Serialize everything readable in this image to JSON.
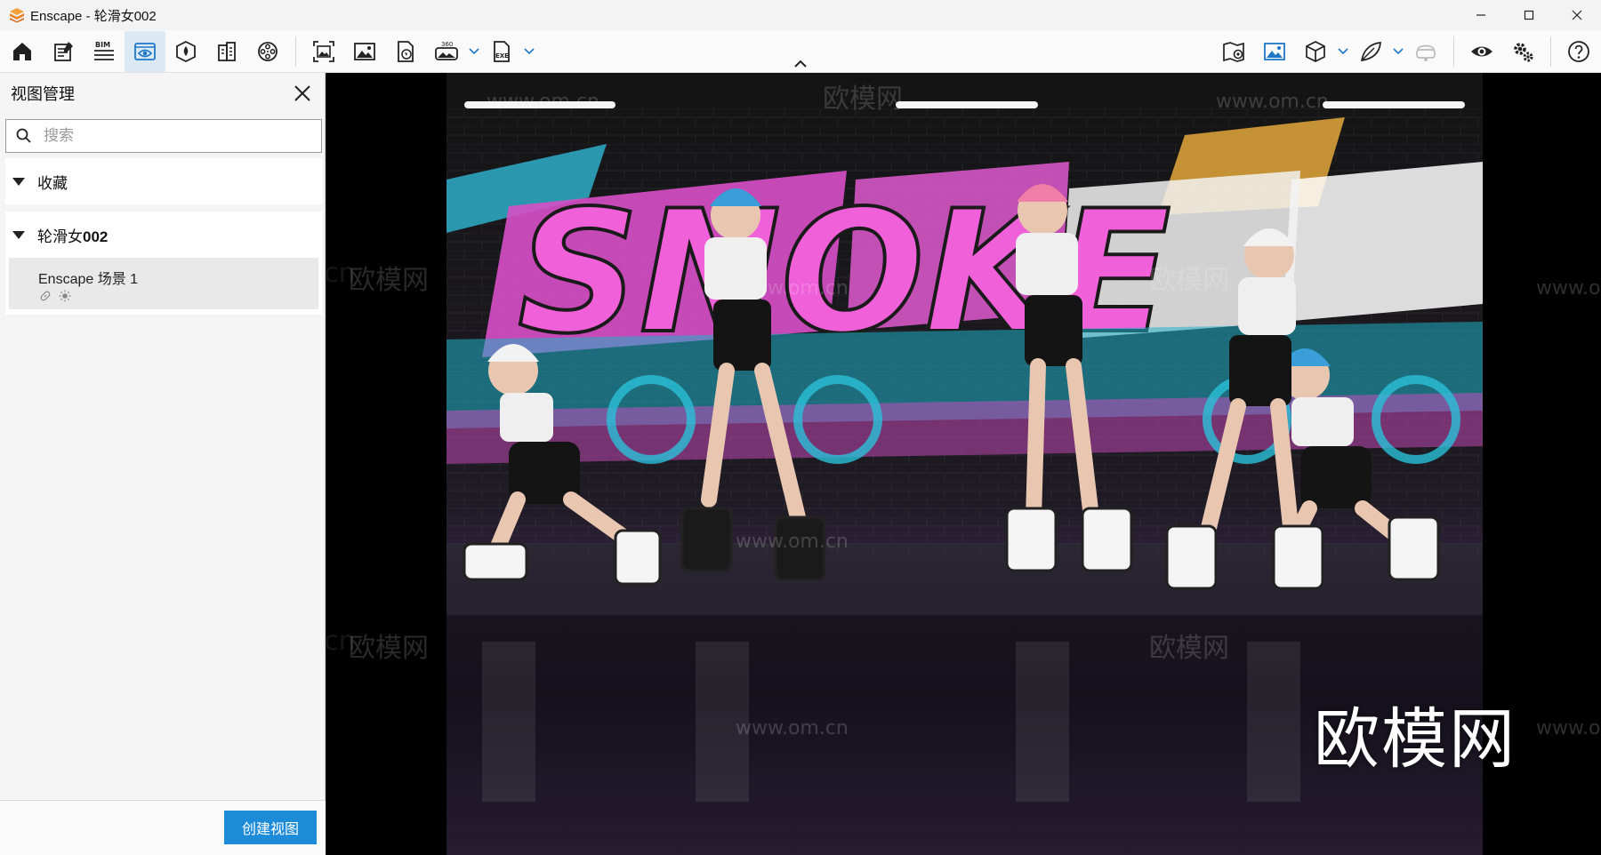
{
  "window": {
    "title": "Enscape - 轮滑女002",
    "controls": [
      "minimize",
      "maximize",
      "close"
    ]
  },
  "toolbar": {
    "left_buttons": [
      {
        "id": "home",
        "icon": "home-icon"
      },
      {
        "id": "notes",
        "icon": "notes-icon"
      },
      {
        "id": "bim",
        "icon": "bim-icon",
        "label": "BIM"
      },
      {
        "id": "views",
        "icon": "eye-view-icon",
        "active": true
      },
      {
        "id": "asset-library",
        "icon": "asset-library-icon"
      },
      {
        "id": "materials",
        "icon": "building-icon"
      },
      {
        "id": "video",
        "icon": "film-reel-icon"
      }
    ],
    "capture_buttons": [
      {
        "id": "batch-render",
        "icon": "batch-render-icon"
      },
      {
        "id": "screenshot",
        "icon": "screenshot-icon"
      },
      {
        "id": "web-export",
        "icon": "web-export-icon"
      },
      {
        "id": "panorama",
        "icon": "panorama-360-icon",
        "label": "360"
      },
      {
        "id": "exe-export",
        "icon": "exe-export-icon",
        "label": "EXE"
      }
    ],
    "right_buttons": [
      {
        "id": "map",
        "icon": "map-pin-icon"
      },
      {
        "id": "render-view",
        "icon": "image-view-icon"
      },
      {
        "id": "cube",
        "icon": "cube-icon"
      },
      {
        "id": "leaf",
        "icon": "leaf-icon"
      },
      {
        "id": "vr",
        "icon": "vr-headset-icon"
      },
      {
        "id": "visual-settings",
        "icon": "eye-icon"
      },
      {
        "id": "settings",
        "icon": "gear-icon"
      },
      {
        "id": "help",
        "icon": "help-icon"
      }
    ]
  },
  "sidebar": {
    "title": "视图管理",
    "search": {
      "placeholder": "搜索",
      "value": ""
    },
    "favorites": {
      "label": "收藏"
    },
    "project": {
      "label_prefix": "轮滑女",
      "label_suffix": "002",
      "views": [
        {
          "name": "Enscape 场景 1"
        }
      ]
    },
    "create_button": "创建视图"
  },
  "viewport": {
    "watermark": "欧模网",
    "watermark_url": "www.om.cn",
    "watermark_url_short": "om.cn",
    "scene_text": "SNOKE"
  }
}
